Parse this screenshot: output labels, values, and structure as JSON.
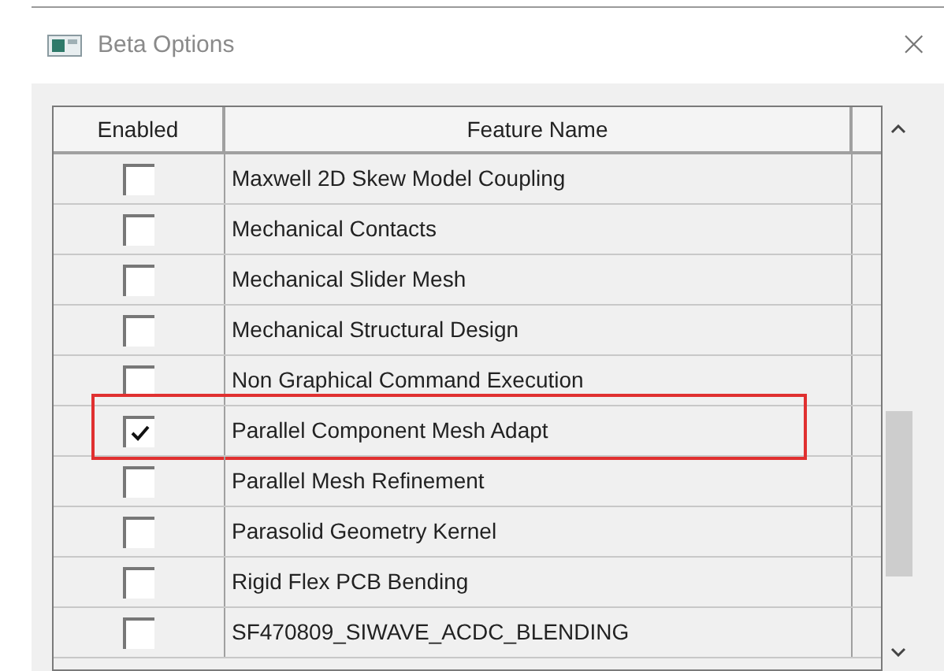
{
  "window": {
    "title": "Beta Options",
    "close": "×"
  },
  "table": {
    "columns": [
      "Enabled",
      "Feature Name"
    ],
    "rows": [
      {
        "name": "Maxwell 2D Skew Model Coupling",
        "checked": false,
        "highlighted": false
      },
      {
        "name": "Mechanical Contacts",
        "checked": false,
        "highlighted": false
      },
      {
        "name": "Mechanical Slider Mesh",
        "checked": false,
        "highlighted": false
      },
      {
        "name": "Mechanical Structural Design",
        "checked": false,
        "highlighted": false
      },
      {
        "name": "Non Graphical Command Execution",
        "checked": false,
        "highlighted": false
      },
      {
        "name": "Parallel Component Mesh Adapt",
        "checked": true,
        "highlighted": true
      },
      {
        "name": "Parallel Mesh Refinement",
        "checked": false,
        "highlighted": false
      },
      {
        "name": "Parasolid Geometry Kernel",
        "checked": false,
        "highlighted": false
      },
      {
        "name": "Rigid Flex PCB Bending",
        "checked": false,
        "highlighted": false
      },
      {
        "name": "SF470809_SIWAVE_ACDC_BLENDING",
        "checked": false,
        "highlighted": false
      }
    ]
  }
}
